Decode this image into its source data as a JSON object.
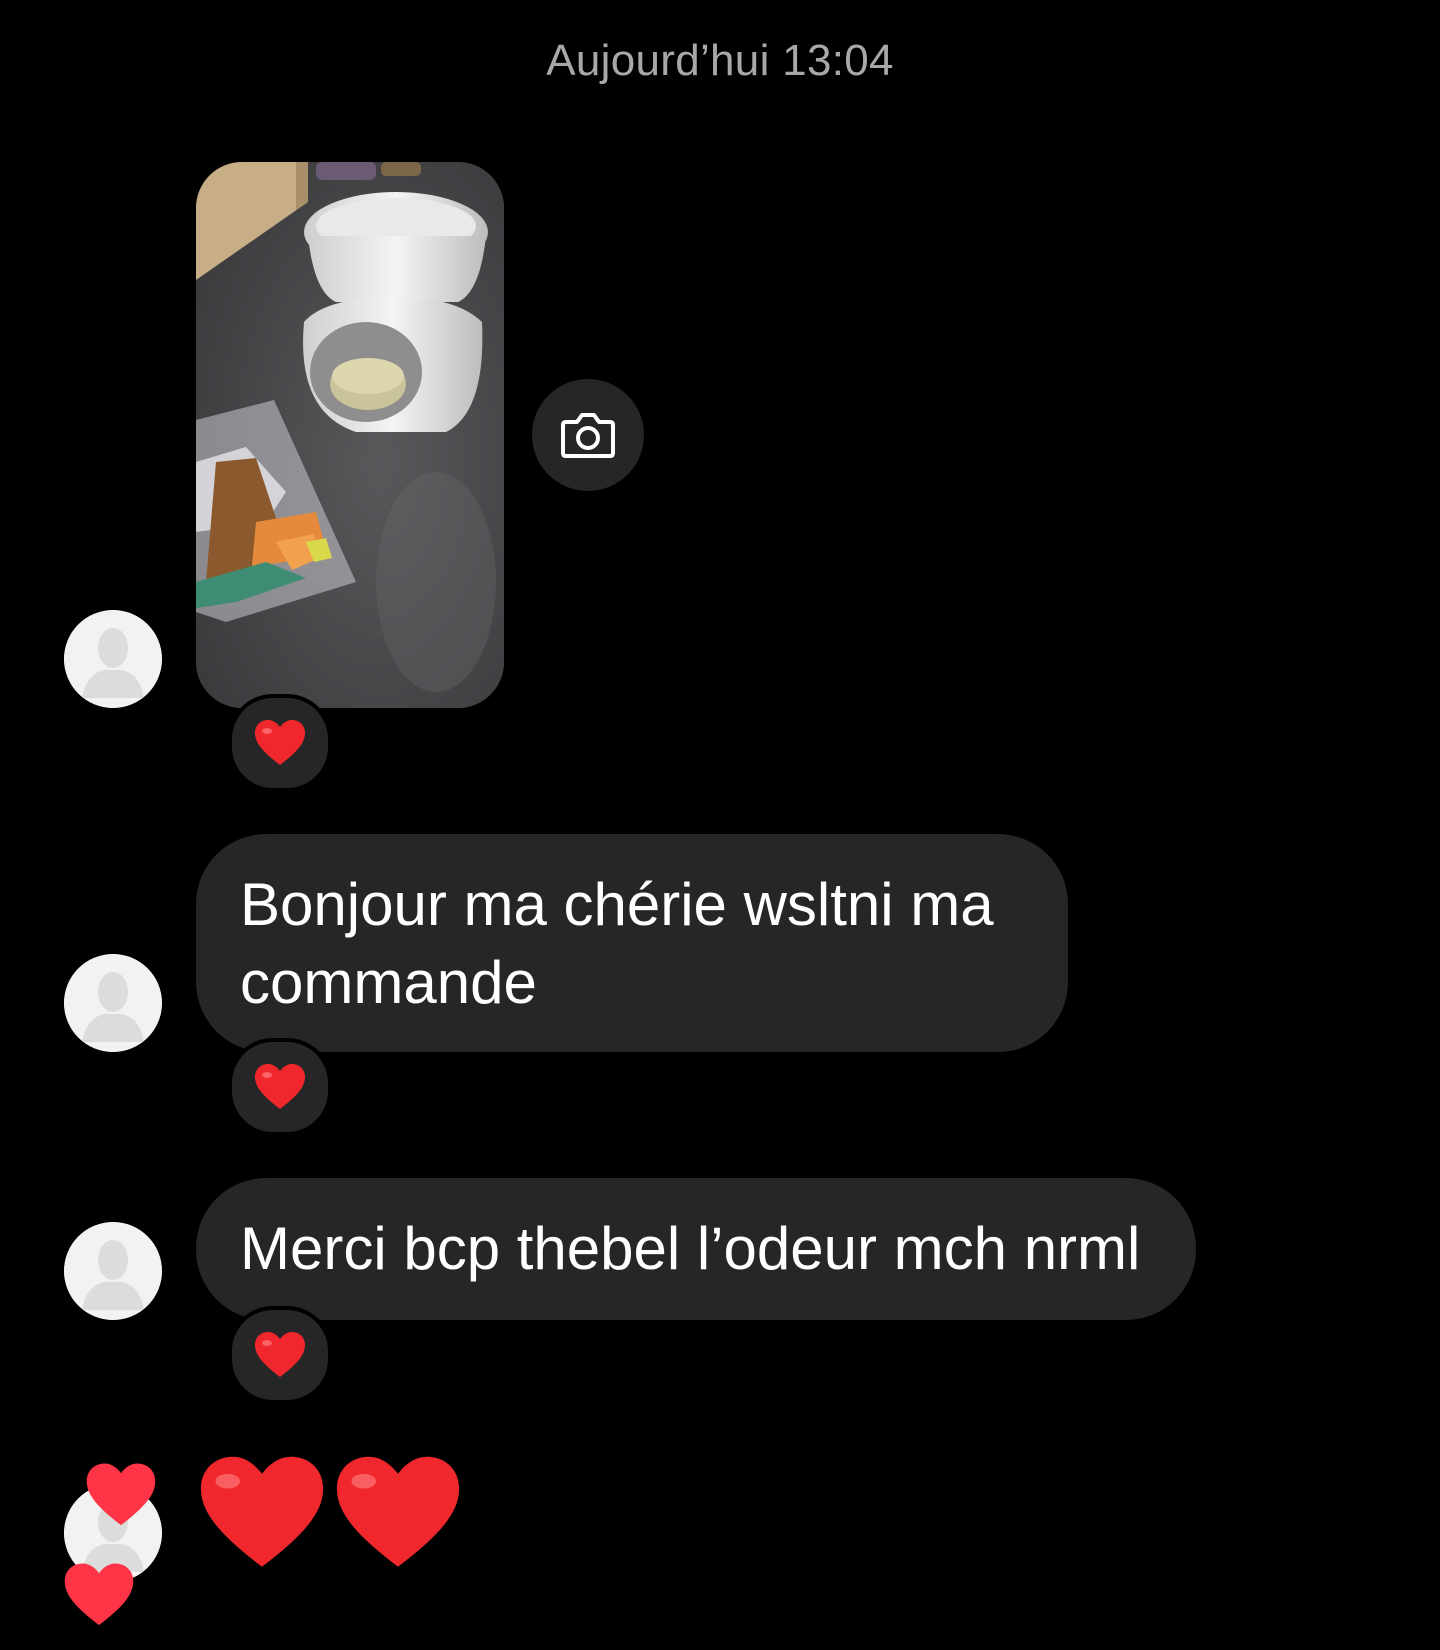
{
  "header": {
    "timestamp": "Aujourd’hui 13:04"
  },
  "colors": {
    "background": "#000000",
    "bubble": "#262626",
    "timestamp_text": "#a8a8a8",
    "heart": "#f0282d",
    "reaction_heart": "#ff3040"
  },
  "messages": [
    {
      "type": "image",
      "description_icon": "camera-icon",
      "reaction": "heart-icon"
    },
    {
      "type": "text",
      "text": "Bonjour ma chérie wsltni ma commande",
      "reaction": "heart-icon"
    },
    {
      "type": "text",
      "text": "Merci bcp thebel l’odeur mch nrml",
      "reaction": "heart-icon"
    },
    {
      "type": "emoji",
      "emoji": "❤️❤️"
    }
  ]
}
